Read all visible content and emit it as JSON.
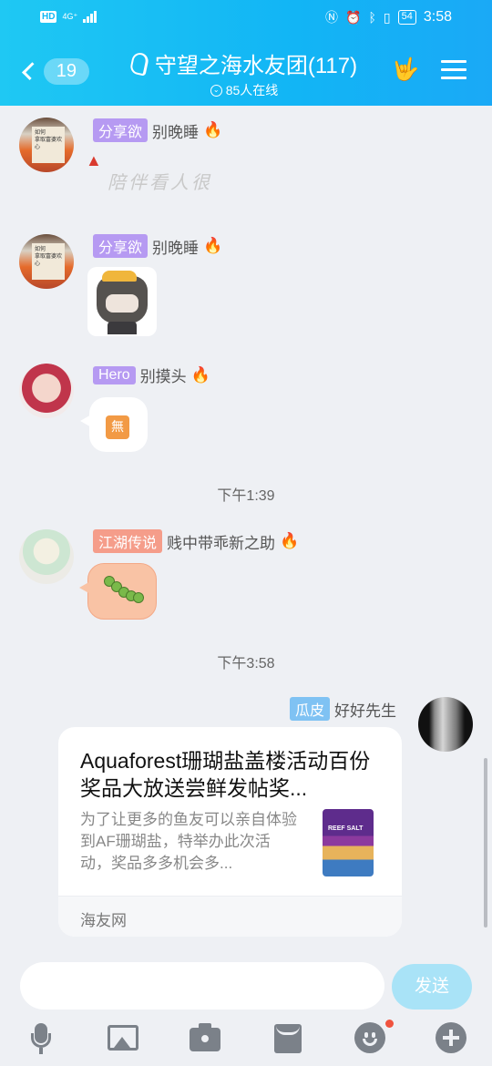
{
  "status_bar": {
    "hd": "HD",
    "network": "4G⁺",
    "battery": "54",
    "time": "3:58"
  },
  "header": {
    "unread_count": "19",
    "title": "守望之海水友团(117)",
    "online": "85人在线"
  },
  "messages": [
    {
      "tag": "分享欲",
      "name": "别晚睡",
      "flame": "🔥",
      "signature": "陪伴看人很"
    },
    {
      "tag": "分享欲",
      "name": "别晚睡",
      "flame": "🔥"
    },
    {
      "tag": "Hero",
      "name": "别摸头",
      "flame": "🔥",
      "sticker_text": "無"
    },
    {
      "tag": "江湖传说",
      "name": "贱中带乖新之助",
      "flame": "🔥"
    }
  ],
  "time_separators": [
    "下午1:39",
    "下午3:58"
  ],
  "own_message": {
    "tag": "瓜皮",
    "name": "好好先生",
    "card": {
      "title": "Aquaforest珊瑚盐盖楼活动百份奖品大放送尝鲜发帖奖...",
      "description": "为了让更多的鱼友可以亲自体验到AF珊瑚盐，特举办此次活动，奖品多多机会多...",
      "image_label": "REEF SALT",
      "source": "海友网"
    }
  },
  "input": {
    "placeholder": "",
    "send_label": "发送"
  },
  "colors": {
    "header_start": "#1fc8f3",
    "header_end": "#1aa9f6",
    "tag_purple": "#b69af2",
    "tag_orange": "#f59d8a",
    "tag_blue": "#7fc2f3",
    "send_button": "#a9e3f7"
  }
}
